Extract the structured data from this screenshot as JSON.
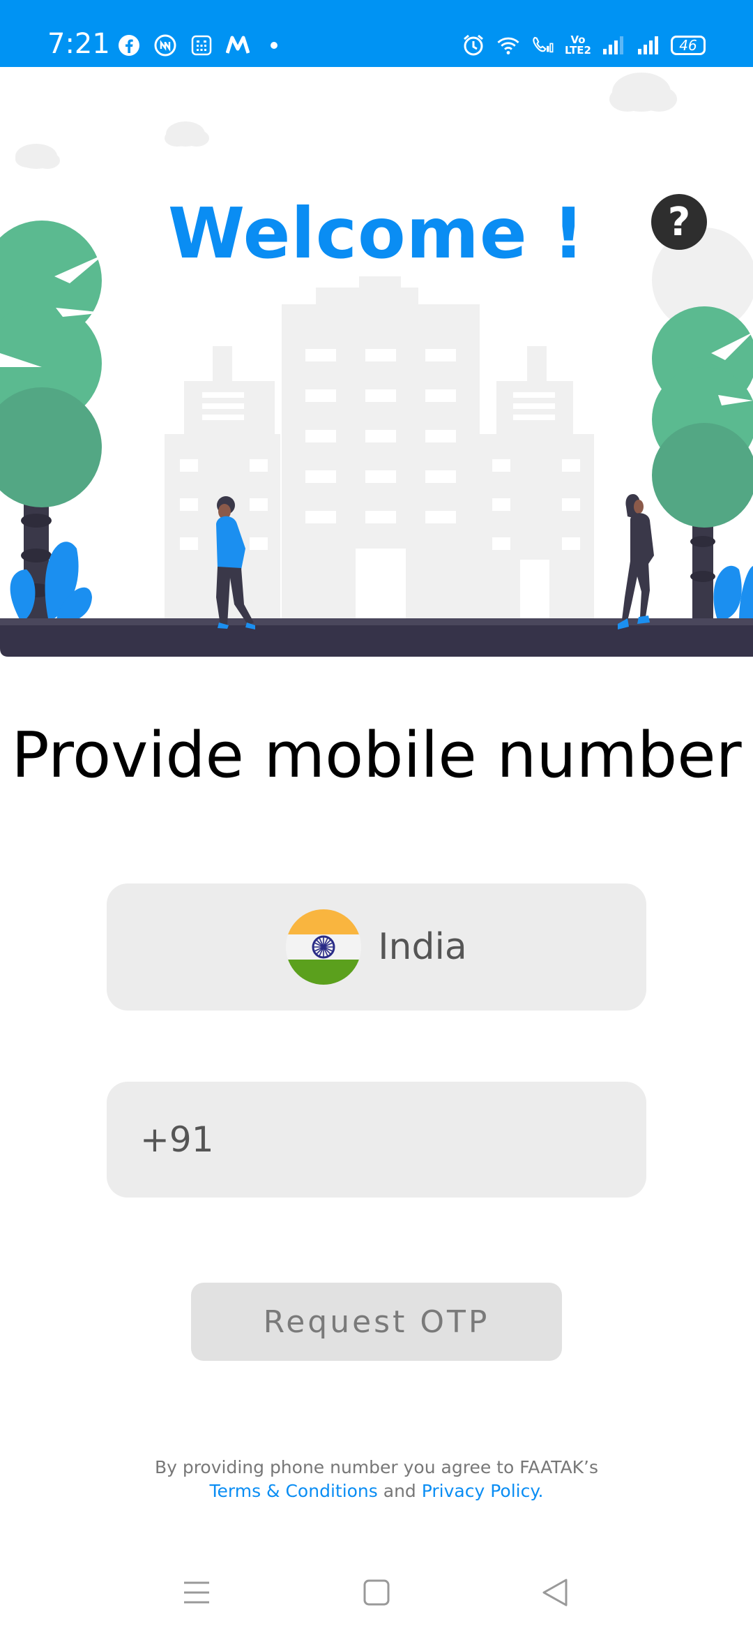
{
  "status_bar": {
    "time": "7:21",
    "battery": "46",
    "volte_top": "Vo",
    "volte_bottom": "LTE2",
    "icons_left": [
      "facebook-icon",
      "app-icon",
      "calculator-icon",
      "myntra-icon",
      "dot-icon"
    ],
    "icons_right": [
      "alarm-icon",
      "wifi-icon",
      "wifi-call-icon",
      "volte-icon",
      "signal-icon",
      "signal-icon",
      "battery-icon"
    ]
  },
  "hero": {
    "welcome": "Welcome !",
    "help_label": "?"
  },
  "form": {
    "heading": "Provide mobile number",
    "country": "India",
    "phone_prefix": "+91",
    "otp_button": "Request OTP"
  },
  "terms": {
    "prefix": "By providing phone number you agree to FAATAK’s",
    "terms_link": "Terms & Conditions",
    "and": " and ",
    "privacy_link": "Privacy Policy."
  },
  "colors": {
    "status_bar": "#0093f3",
    "accent": "#0a8df3",
    "field_bg": "#ececec",
    "button_bg": "#e1e1e1"
  },
  "nav": [
    "menu-icon",
    "home-icon",
    "back-icon"
  ]
}
